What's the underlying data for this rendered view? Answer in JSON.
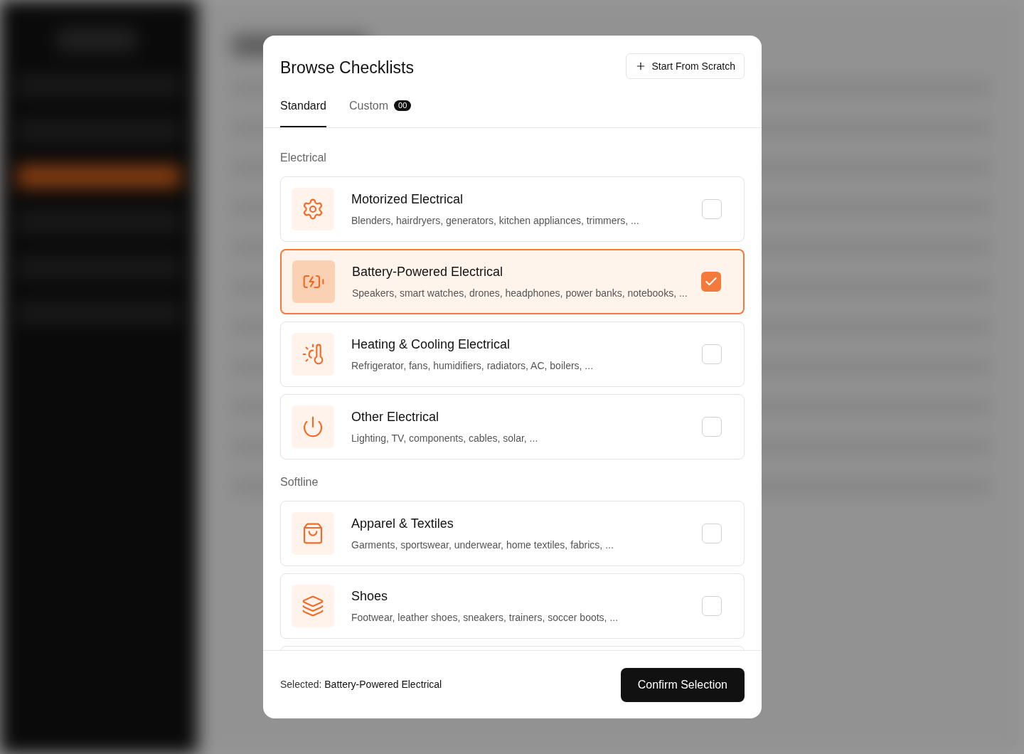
{
  "dialog": {
    "title": "Browse Checklists",
    "action_button": "Start From Scratch",
    "tabs": [
      {
        "label": "Standard",
        "selected": true
      },
      {
        "label": "Custom",
        "badge": "00",
        "selected": false
      }
    ],
    "sections": [
      {
        "heading": "Electrical",
        "items": [
          {
            "title": "Motorized Electrical",
            "description": "Blenders, hairdryers, generators, kitchen appliances, trimmers, ...",
            "selected": false
          },
          {
            "title": "Battery-Powered Electrical",
            "description": "Speakers, smart watches, drones, headphones, power banks, notebooks, ...",
            "selected": true
          },
          {
            "title": "Heating & Cooling Electrical",
            "description": "Refrigerator, fans, humidifiers, radiators, AC, boilers, ...",
            "selected": false
          },
          {
            "title": "Other Electrical",
            "description": "Lighting, TV, components, cables, solar, ...",
            "selected": false
          }
        ]
      },
      {
        "heading": "Softline",
        "items": [
          {
            "title": "Apparel & Textiles",
            "description": "Garments, sportswear, underwear, home textiles, fabrics, ...",
            "selected": false
          },
          {
            "title": "Shoes",
            "description": "Footwear, leather shoes, sneakers, trainers, soccer boots, ...",
            "selected": false
          }
        ]
      }
    ],
    "footer": {
      "selected_label": "Selected:",
      "selected_value": "Battery-Powered Electrical",
      "confirm_button": "Confirm Selection"
    }
  }
}
